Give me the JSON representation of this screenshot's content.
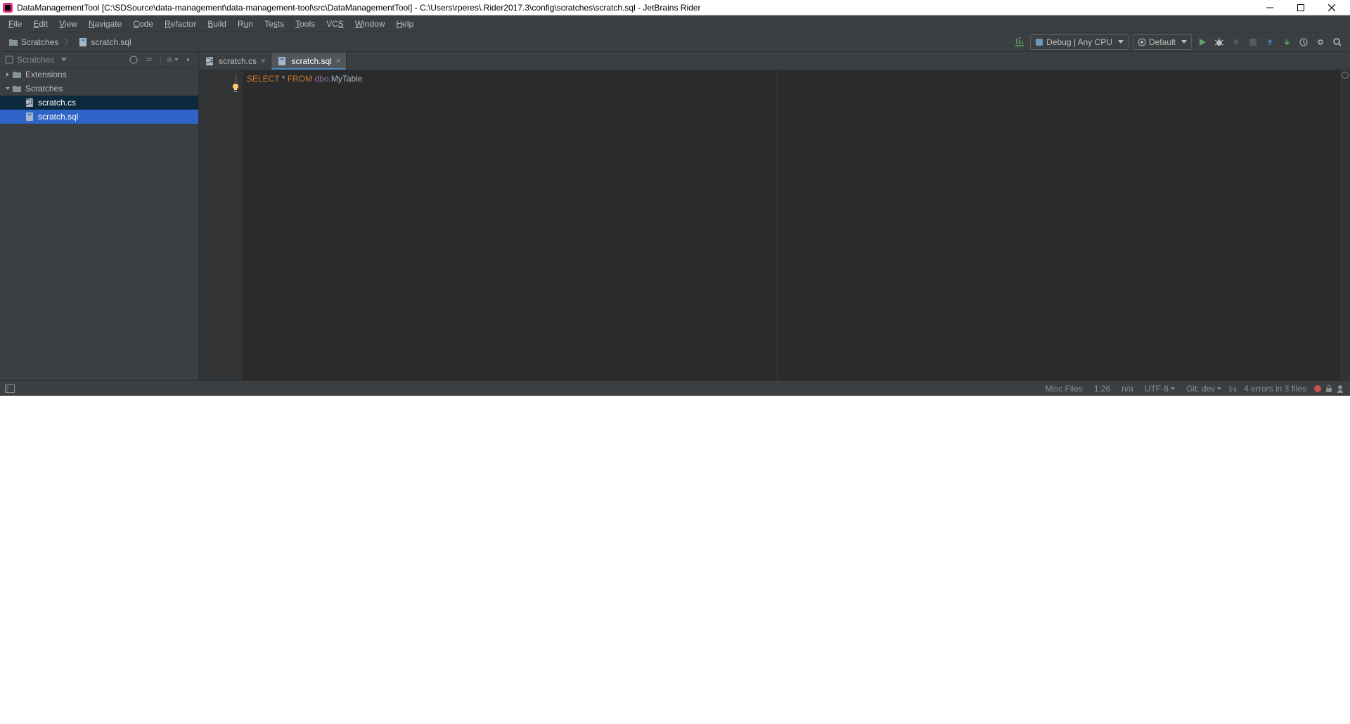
{
  "titlebar": {
    "text": "DataManagementTool [C:\\SDSource\\data-management\\data-management-tool\\src\\DataManagementTool] - C:\\Users\\rperes\\.Rider2017.3\\config\\scratches\\scratch.sql - JetBrains Rider"
  },
  "menu": {
    "items": [
      "File",
      "Edit",
      "View",
      "Navigate",
      "Code",
      "Refactor",
      "Build",
      "Run",
      "Tests",
      "Tools",
      "VCS",
      "Window",
      "Help"
    ]
  },
  "breadcrumb": {
    "items": [
      "Scratches",
      "scratch.sql"
    ]
  },
  "toolbar": {
    "config_label": "Debug | Any CPU",
    "target_label": "Default"
  },
  "project_panel": {
    "title": "Scratches",
    "tree": [
      {
        "label": "Extensions",
        "depth": 0,
        "expanded": false,
        "icon": "folder",
        "sel": ""
      },
      {
        "label": "Scratches",
        "depth": 0,
        "expanded": true,
        "icon": "folder",
        "sel": ""
      },
      {
        "label": "scratch.cs",
        "depth": 1,
        "expanded": null,
        "icon": "csharp",
        "sel": "inactive"
      },
      {
        "label": "scratch.sql",
        "depth": 1,
        "expanded": null,
        "icon": "sql",
        "sel": "active"
      }
    ]
  },
  "tabs": [
    {
      "label": "scratch.cs",
      "icon": "csharp",
      "active": false
    },
    {
      "label": "scratch.sql",
      "icon": "sql",
      "active": true
    }
  ],
  "editor": {
    "line_number": "1",
    "code_tokens": [
      {
        "t": "SELECT",
        "c": "kw"
      },
      {
        "t": " * ",
        "c": ""
      },
      {
        "t": "FROM",
        "c": "kw"
      },
      {
        "t": " ",
        "c": ""
      },
      {
        "t": "dbo",
        "c": "ident"
      },
      {
        "t": ".MyTable",
        "c": ""
      }
    ]
  },
  "statusbar": {
    "misc": "Misc Files",
    "pos": "1:26",
    "na": "n/a",
    "encoding": "UTF-8",
    "git": "Git: dev",
    "errors": "4 errors in 3 files"
  }
}
